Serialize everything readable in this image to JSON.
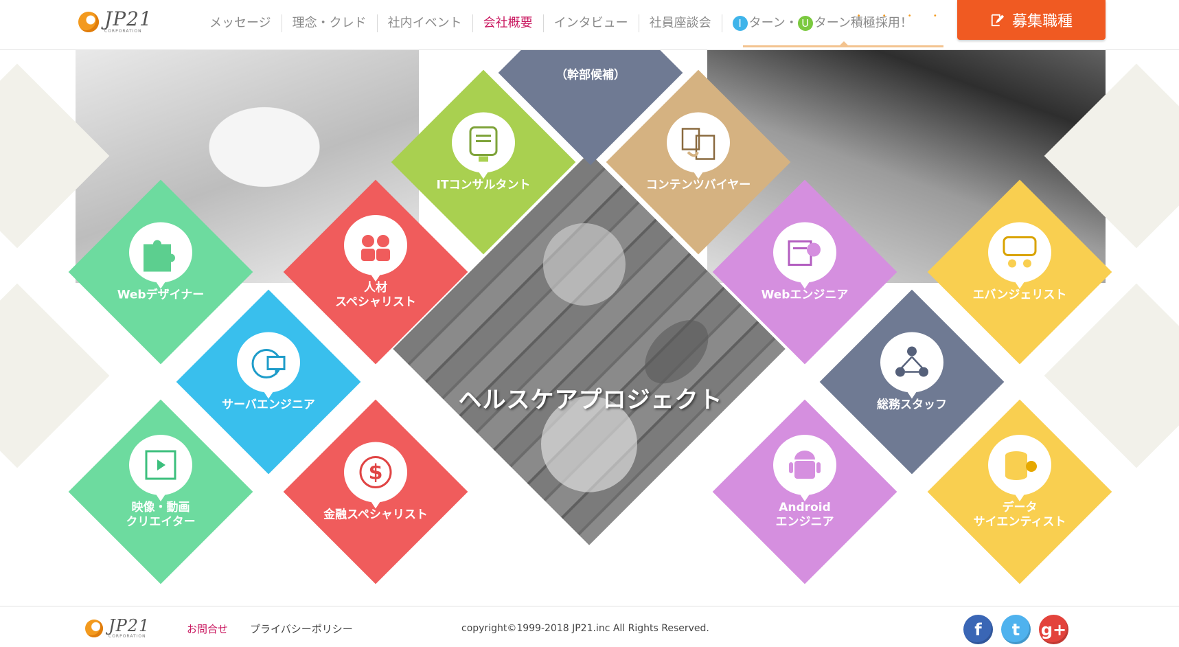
{
  "brand": {
    "name": "JP21",
    "sub": "CORPORATION"
  },
  "nav": {
    "items": [
      "メッセージ",
      "理念・クレド",
      "社内イベント",
      "会社概要",
      "インタビュー",
      "社員座談会"
    ],
    "active_index": 3,
    "iu": {
      "i_badge": "I",
      "u_badge": "U",
      "prefix": "ターン・",
      "suffix": "ターン積極採用！",
      "dots": "• • • •"
    }
  },
  "recruit_button": {
    "label": "募集職種"
  },
  "center_project": {
    "label": "ヘルスケアプロジェクト"
  },
  "tiles": [
    {
      "label": "Webデザイナー",
      "icon": "puzzle-icon",
      "color": "#6ddb9f"
    },
    {
      "label": "人材\nスペシャリスト",
      "icon": "people-icon",
      "color": "#f05c5c"
    },
    {
      "label": "ITコンサルタント",
      "icon": "presentation-icon",
      "color": "#a9d050"
    },
    {
      "label": "（幹部候補）",
      "icon": "",
      "color": "#6f7a93"
    },
    {
      "label": "コンテンツバイヤー",
      "icon": "documents-icon",
      "color": "#d5b281"
    },
    {
      "label": "Webエンジニア",
      "icon": "gear-web-icon",
      "color": "#d58fdf"
    },
    {
      "label": "エバンジェリスト",
      "icon": "speech-icon",
      "color": "#f9cf50"
    },
    {
      "label": "サーバエンジニア",
      "icon": "server-icon",
      "color": "#39bfed"
    },
    {
      "label": "総務スタッフ",
      "icon": "network-icon",
      "color": "#6f7a93"
    },
    {
      "label": "映像・動画\nクリエイター",
      "icon": "video-icon",
      "color": "#6ddb9f"
    },
    {
      "label": "金融スペシャリスト",
      "icon": "dollar-icon",
      "color": "#f05c5c"
    },
    {
      "label": "Android\nエンジニア",
      "icon": "android-icon",
      "color": "#d58fdf"
    },
    {
      "label": "データ\nサイエンティスト",
      "icon": "database-icon",
      "color": "#f9cf50"
    }
  ],
  "footer": {
    "contact": "お問合せ",
    "privacy": "プライバシーポリシー",
    "copyright": "copyright©1999-2018 JP21.inc All Rights Reserved.",
    "social": [
      {
        "icon": "facebook-icon",
        "glyph": "f",
        "color": "#3a66b5"
      },
      {
        "icon": "twitter-icon",
        "glyph": "t",
        "color": "#4fb2ee"
      },
      {
        "icon": "google-plus-icon",
        "glyph": "g+",
        "color": "#e3433c"
      }
    ]
  },
  "colors": {
    "active_nav": "#c9175f",
    "accent_orange": "#f05a22",
    "i_badge": "#3fb4ea",
    "u_badge": "#7bc93f"
  }
}
